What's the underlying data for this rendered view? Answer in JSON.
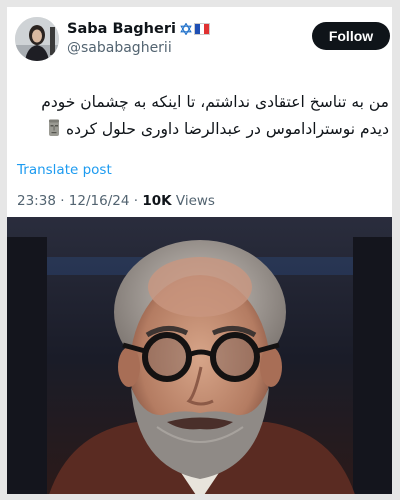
{
  "header": {
    "display_name": "Saba Bagheri",
    "emoji_icons": [
      "star-of-david-icon",
      "france-flag-icon"
    ],
    "handle": "@sababagherii",
    "follow_label": "Follow"
  },
  "tweet": {
    "text_line1": "من به تناسخ اعتقادی نداشتم، تا اینکه به چشمان خودم",
    "text_line2": "دیدم نوستراداموس در عبدالرضا داوری حلول کرده",
    "trailing_emoji": "moai-icon",
    "translate_label": "Translate post",
    "time": "23:38",
    "date": "12/16/24",
    "views_count": "10K",
    "views_label": "Views"
  },
  "colors": {
    "accent": "#1d9bf0",
    "text": "#0f1419",
    "muted": "#536471",
    "follow_bg": "#0f1419"
  }
}
